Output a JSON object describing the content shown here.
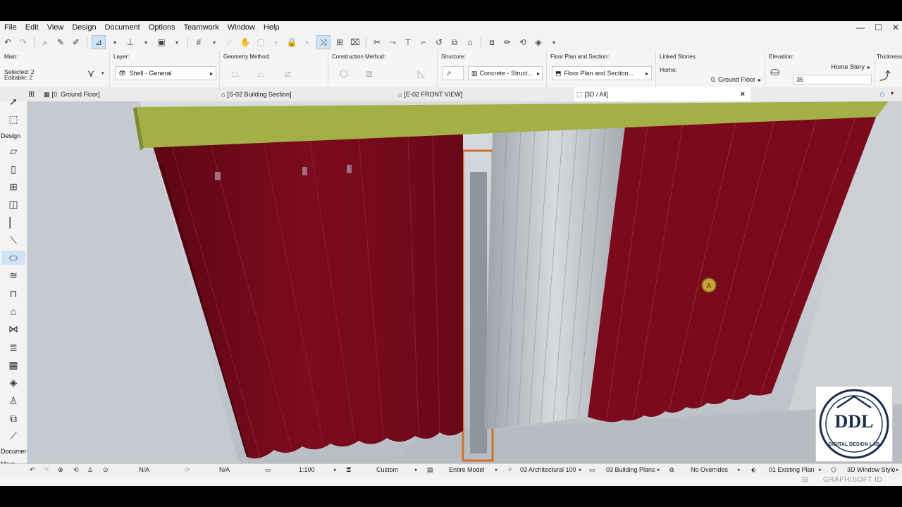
{
  "menu": {
    "items": [
      "File",
      "Edit",
      "View",
      "Design",
      "Document",
      "Options",
      "Teamwork",
      "Window",
      "Help"
    ]
  },
  "window_controls": {
    "minimize": "—",
    "maximize": "☐",
    "close": "✕"
  },
  "infobox": {
    "main": {
      "title": "Main:",
      "selected": "Selected: 2",
      "editable": "Editable: 2"
    },
    "layer": {
      "title": "Layer:",
      "value": "Shell - General"
    },
    "geometry": {
      "title": "Geometry Method:"
    },
    "construction": {
      "title": "Construction Method:"
    },
    "structure": {
      "title": "Structure:",
      "value": "Concrete - Struct..."
    },
    "floorplan": {
      "title": "Floor Plan and Section:",
      "value": "Floor Plan and Section..."
    },
    "linked": {
      "title": "Linked Stories:",
      "home_label": "Home:",
      "home_value": "0. Ground Floor"
    },
    "elevation": {
      "title": "Elevation:",
      "ref": "Home Story",
      "value": "36"
    },
    "thickness": {
      "title": "Thickness:"
    }
  },
  "tabs": [
    {
      "label": "[0. Ground Floor]"
    },
    {
      "label": "[S-02 Building Section]"
    },
    {
      "label": "[E-02 FRONT VIEW]"
    },
    {
      "label": "[3D / All]"
    }
  ],
  "tab_close": "×",
  "toolbox": {
    "design_label": "Design",
    "document_label": "Documer",
    "more_label": "More"
  },
  "status": {
    "na1": "N/A",
    "na2": "N/A",
    "scale": "1:100",
    "custom": "Custom",
    "model": "Entire Model",
    "pen_set": "03 Architectural 100",
    "model_view": "03 Building Plans",
    "overrides": "No Overrides",
    "renovation": "01 Existing Plan",
    "window_style": "3D Window Style"
  },
  "footer": {
    "brand": "GRAPHISOFT ID"
  },
  "logo": {
    "main": "DDL",
    "sub": "DIGITAL DESIGN LAB"
  },
  "marker": {
    "label": "A"
  },
  "colors": {
    "curtain": "#7a0a1c",
    "pelmet": "#a2b046",
    "glass": "#c3c7cc",
    "frame": "#d0712a",
    "background": "#cfd4da"
  }
}
